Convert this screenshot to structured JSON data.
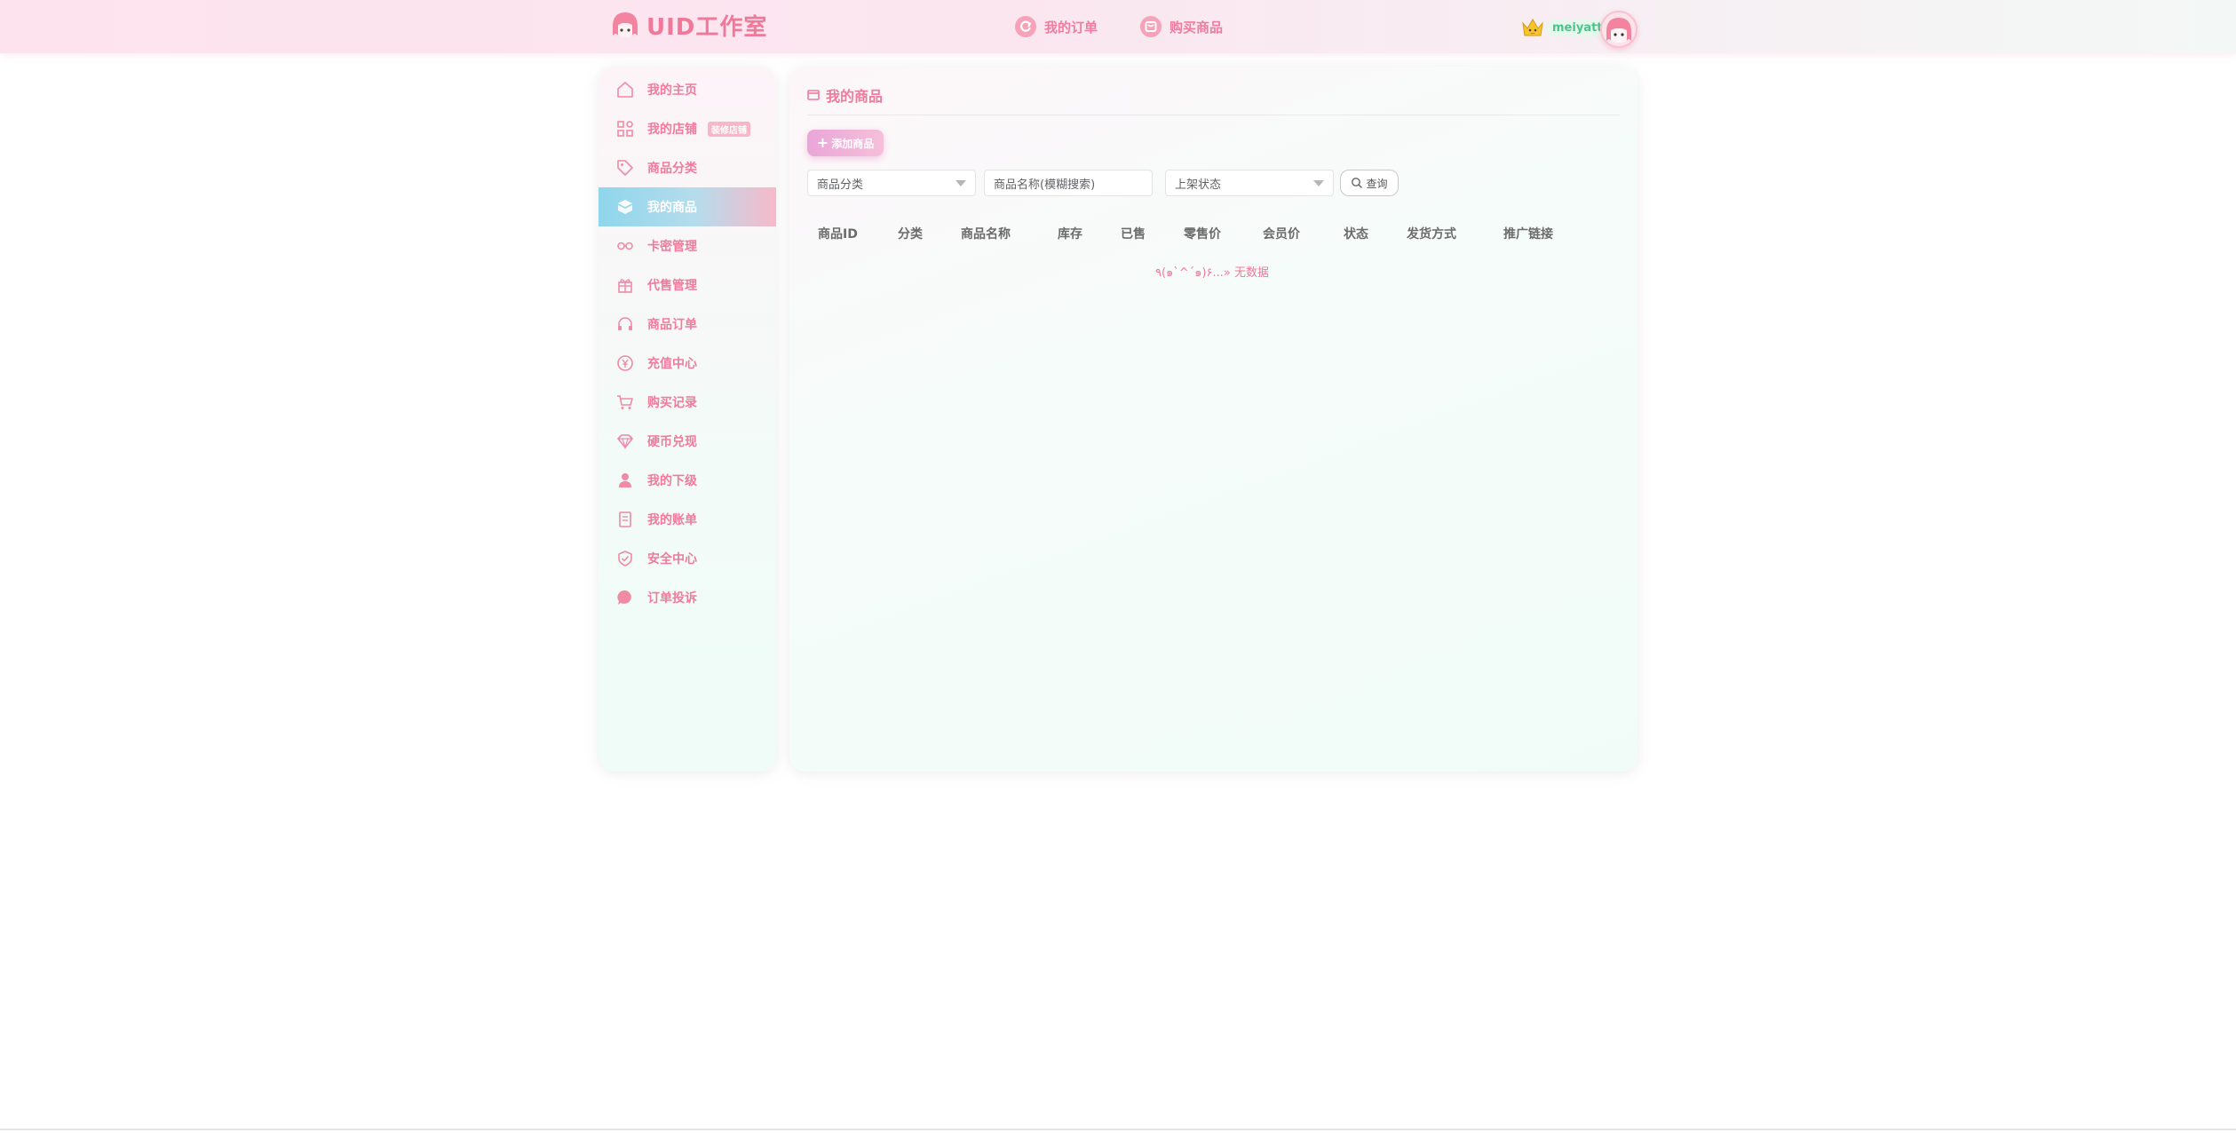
{
  "header": {
    "brand": "UID工作室",
    "nav": [
      {
        "label": "我的订单",
        "icon": "refresh-circle-icon"
      },
      {
        "label": "购买商品",
        "icon": "shop-bag-icon"
      }
    ],
    "username": "meiyatt"
  },
  "sidebar": {
    "items": [
      {
        "label": "我的主页",
        "icon": "home-icon"
      },
      {
        "label": "我的店铺",
        "icon": "shop-grid-icon",
        "badge": "装修店铺"
      },
      {
        "label": "商品分类",
        "icon": "tag-icon"
      },
      {
        "label": "我的商品",
        "icon": "cube-icon",
        "active": true
      },
      {
        "label": "卡密管理",
        "icon": "key-link-icon"
      },
      {
        "label": "代售管理",
        "icon": "gift-icon"
      },
      {
        "label": "商品订单",
        "icon": "headset-icon"
      },
      {
        "label": "充值中心",
        "icon": "yen-circle-icon"
      },
      {
        "label": "购买记录",
        "icon": "cart-icon"
      },
      {
        "label": "硬币兑现",
        "icon": "diamond-icon"
      },
      {
        "label": "我的下级",
        "icon": "user-icon"
      },
      {
        "label": "我的账单",
        "icon": "bill-icon"
      },
      {
        "label": "安全中心",
        "icon": "shield-check-icon"
      },
      {
        "label": "订单投诉",
        "icon": "chat-bubble-icon"
      }
    ]
  },
  "main": {
    "title": "我的商品",
    "add_button": "添加商品",
    "filters": {
      "category_placeholder": "商品分类",
      "name_placeholder": "商品名称(模糊搜索)",
      "status_placeholder": "上架状态",
      "search_button": "查询"
    },
    "columns": [
      "商品ID",
      "分类",
      "商品名称",
      "库存",
      "已售",
      "零售价",
      "会员价",
      "状态",
      "发货方式",
      "推广链接"
    ],
    "empty_text": "٩(๑`^´๑)۶...» 无数据"
  },
  "colors": {
    "accent": "#f07b9c",
    "active_gradient_start": "#8fd6ec",
    "active_gradient_end": "#f7b9c9",
    "username_green": "#4cc38a"
  }
}
